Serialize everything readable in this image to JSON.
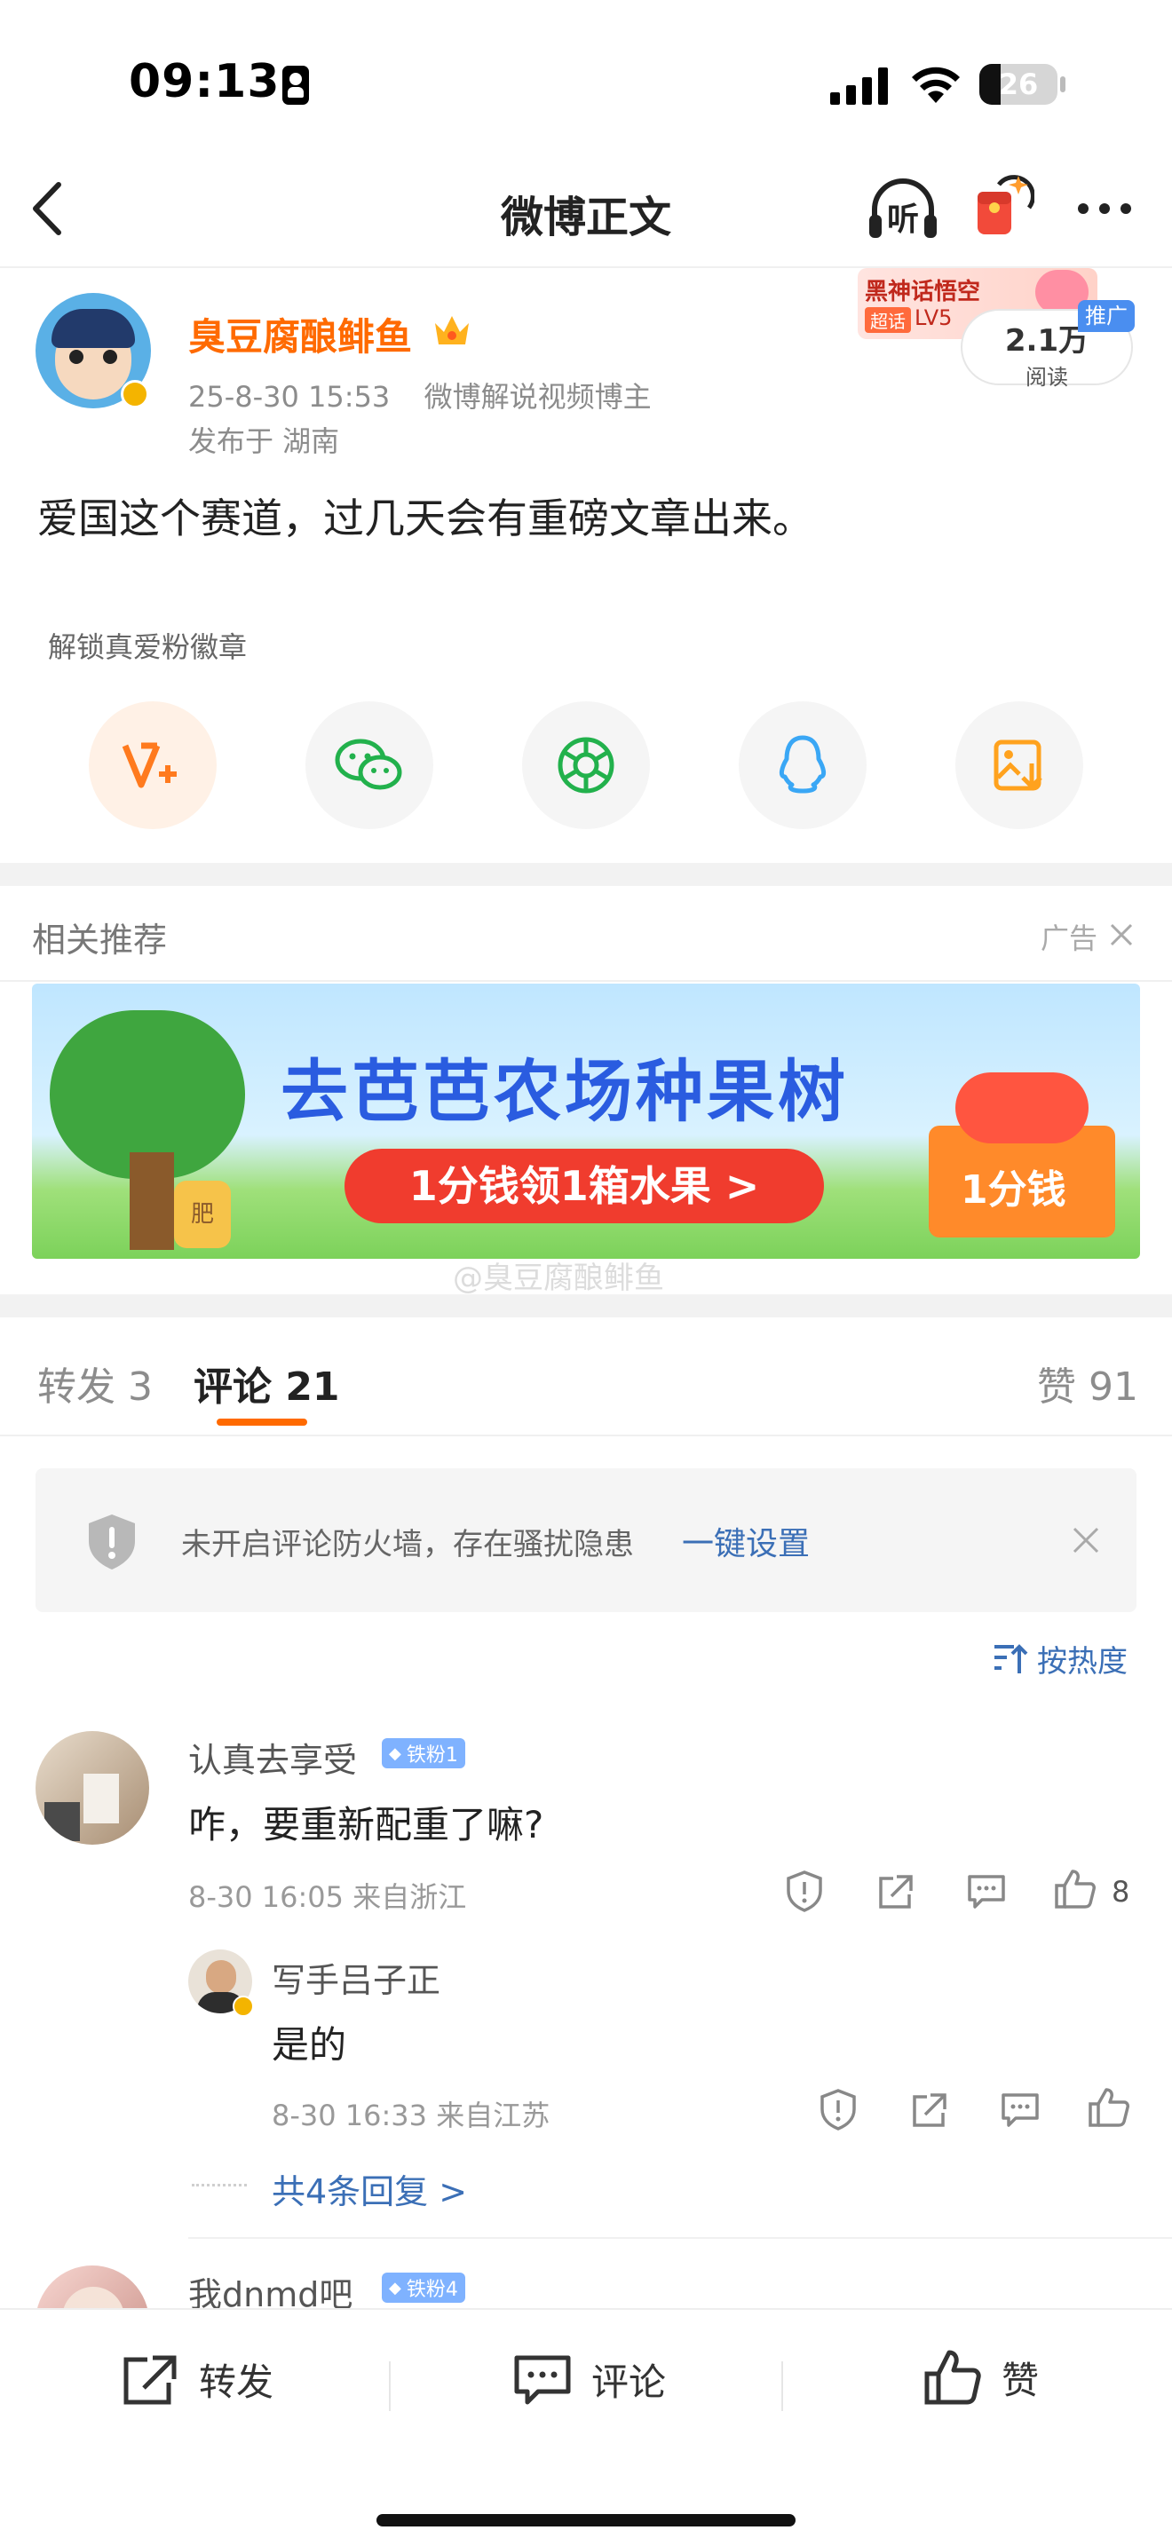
{
  "status_bar": {
    "time": "09:13",
    "battery": "26"
  },
  "nav": {
    "title": "微博正文",
    "listen_label": "听"
  },
  "post": {
    "author": "臭豆腐酿鲱鱼",
    "timestamp": "25-8-30 15:53",
    "author_title": "微博解说视频博主",
    "location": "发布于 湖南",
    "text": "爱国这个赛道，过几天会有重磅文章出来。",
    "reads_count": "2.1万",
    "reads_label": "阅读",
    "promo_tag": "推广",
    "promo_topic": "黑神话悟空",
    "promo_level": "LV5",
    "promo_badge": "超话"
  },
  "share": {
    "unlock_label": "解锁真爱粉徽章",
    "items": [
      "fan-badge",
      "wechat",
      "moments",
      "qq",
      "save-image"
    ]
  },
  "recommend": {
    "title": "相关推荐",
    "ad_label": "广告",
    "banner_title": "去芭芭农场种果树",
    "banner_button": "1分钱领1箱水果 >",
    "banner_price": "1分钱",
    "banner_fert": "肥",
    "watermark": "@臭豆腐酿鲱鱼"
  },
  "tabs": {
    "repost": "转发 3",
    "comment": "评论 21",
    "like": "赞 91"
  },
  "firewall": {
    "text": "未开启评论防火墙，存在骚扰隐患",
    "action": "一键设置"
  },
  "sort_label": "按热度",
  "comments": [
    {
      "name": "认真去享受",
      "badge": "铁粉1",
      "text": "咋，要重新配重了嘛?",
      "meta": "8-30 16:05  来自浙江",
      "likes": "8",
      "reply": {
        "name": "写手吕子正",
        "text": "是的",
        "meta": "8-30 16:33  来自江苏"
      },
      "more_replies": "共4条回复 >"
    },
    {
      "name": "我dnmd吧",
      "badge": "铁粉4"
    }
  ],
  "bottom_bar": {
    "repost": "转发",
    "comment": "评论",
    "like": "赞"
  },
  "colors": {
    "accent": "#ff6a00",
    "link": "#3b6fb6",
    "badge": "#7fb2ff"
  }
}
